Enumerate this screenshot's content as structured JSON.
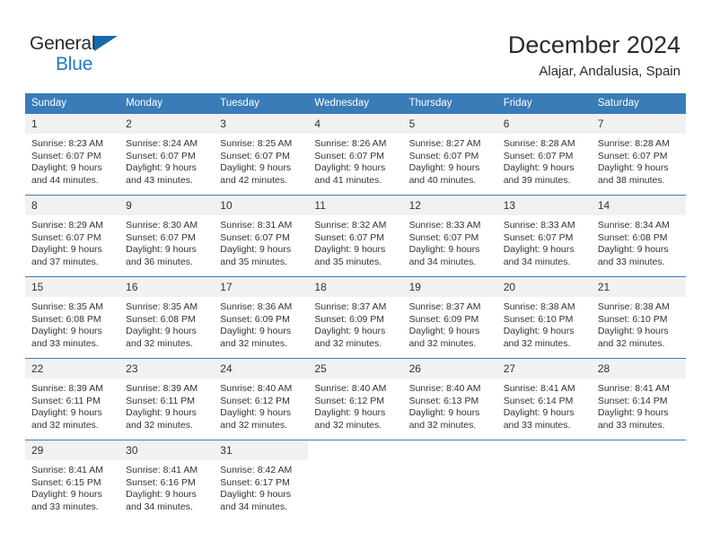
{
  "brand": {
    "line1": "General",
    "line2": "Blue",
    "triangle_icon": "triangle-icon",
    "color_dark": "#2b2b2b",
    "color_blue": "#1f7bc1"
  },
  "header": {
    "title": "December 2024",
    "subtitle": "Alajar, Andalusia, Spain"
  },
  "calendar": {
    "accent_color": "#3a7cb8",
    "daynum_background": "#f1f1f1",
    "weekday_headers": [
      "Sunday",
      "Monday",
      "Tuesday",
      "Wednesday",
      "Thursday",
      "Friday",
      "Saturday"
    ],
    "weeks": [
      [
        {
          "day": "1",
          "sunrise": "Sunrise: 8:23 AM",
          "sunset": "Sunset: 6:07 PM",
          "daylight_line1": "Daylight: 9 hours",
          "daylight_line2": "and 44 minutes."
        },
        {
          "day": "2",
          "sunrise": "Sunrise: 8:24 AM",
          "sunset": "Sunset: 6:07 PM",
          "daylight_line1": "Daylight: 9 hours",
          "daylight_line2": "and 43 minutes."
        },
        {
          "day": "3",
          "sunrise": "Sunrise: 8:25 AM",
          "sunset": "Sunset: 6:07 PM",
          "daylight_line1": "Daylight: 9 hours",
          "daylight_line2": "and 42 minutes."
        },
        {
          "day": "4",
          "sunrise": "Sunrise: 8:26 AM",
          "sunset": "Sunset: 6:07 PM",
          "daylight_line1": "Daylight: 9 hours",
          "daylight_line2": "and 41 minutes."
        },
        {
          "day": "5",
          "sunrise": "Sunrise: 8:27 AM",
          "sunset": "Sunset: 6:07 PM",
          "daylight_line1": "Daylight: 9 hours",
          "daylight_line2": "and 40 minutes."
        },
        {
          "day": "6",
          "sunrise": "Sunrise: 8:28 AM",
          "sunset": "Sunset: 6:07 PM",
          "daylight_line1": "Daylight: 9 hours",
          "daylight_line2": "and 39 minutes."
        },
        {
          "day": "7",
          "sunrise": "Sunrise: 8:28 AM",
          "sunset": "Sunset: 6:07 PM",
          "daylight_line1": "Daylight: 9 hours",
          "daylight_line2": "and 38 minutes."
        }
      ],
      [
        {
          "day": "8",
          "sunrise": "Sunrise: 8:29 AM",
          "sunset": "Sunset: 6:07 PM",
          "daylight_line1": "Daylight: 9 hours",
          "daylight_line2": "and 37 minutes."
        },
        {
          "day": "9",
          "sunrise": "Sunrise: 8:30 AM",
          "sunset": "Sunset: 6:07 PM",
          "daylight_line1": "Daylight: 9 hours",
          "daylight_line2": "and 36 minutes."
        },
        {
          "day": "10",
          "sunrise": "Sunrise: 8:31 AM",
          "sunset": "Sunset: 6:07 PM",
          "daylight_line1": "Daylight: 9 hours",
          "daylight_line2": "and 35 minutes."
        },
        {
          "day": "11",
          "sunrise": "Sunrise: 8:32 AM",
          "sunset": "Sunset: 6:07 PM",
          "daylight_line1": "Daylight: 9 hours",
          "daylight_line2": "and 35 minutes."
        },
        {
          "day": "12",
          "sunrise": "Sunrise: 8:33 AM",
          "sunset": "Sunset: 6:07 PM",
          "daylight_line1": "Daylight: 9 hours",
          "daylight_line2": "and 34 minutes."
        },
        {
          "day": "13",
          "sunrise": "Sunrise: 8:33 AM",
          "sunset": "Sunset: 6:07 PM",
          "daylight_line1": "Daylight: 9 hours",
          "daylight_line2": "and 34 minutes."
        },
        {
          "day": "14",
          "sunrise": "Sunrise: 8:34 AM",
          "sunset": "Sunset: 6:08 PM",
          "daylight_line1": "Daylight: 9 hours",
          "daylight_line2": "and 33 minutes."
        }
      ],
      [
        {
          "day": "15",
          "sunrise": "Sunrise: 8:35 AM",
          "sunset": "Sunset: 6:08 PM",
          "daylight_line1": "Daylight: 9 hours",
          "daylight_line2": "and 33 minutes."
        },
        {
          "day": "16",
          "sunrise": "Sunrise: 8:35 AM",
          "sunset": "Sunset: 6:08 PM",
          "daylight_line1": "Daylight: 9 hours",
          "daylight_line2": "and 32 minutes."
        },
        {
          "day": "17",
          "sunrise": "Sunrise: 8:36 AM",
          "sunset": "Sunset: 6:09 PM",
          "daylight_line1": "Daylight: 9 hours",
          "daylight_line2": "and 32 minutes."
        },
        {
          "day": "18",
          "sunrise": "Sunrise: 8:37 AM",
          "sunset": "Sunset: 6:09 PM",
          "daylight_line1": "Daylight: 9 hours",
          "daylight_line2": "and 32 minutes."
        },
        {
          "day": "19",
          "sunrise": "Sunrise: 8:37 AM",
          "sunset": "Sunset: 6:09 PM",
          "daylight_line1": "Daylight: 9 hours",
          "daylight_line2": "and 32 minutes."
        },
        {
          "day": "20",
          "sunrise": "Sunrise: 8:38 AM",
          "sunset": "Sunset: 6:10 PM",
          "daylight_line1": "Daylight: 9 hours",
          "daylight_line2": "and 32 minutes."
        },
        {
          "day": "21",
          "sunrise": "Sunrise: 8:38 AM",
          "sunset": "Sunset: 6:10 PM",
          "daylight_line1": "Daylight: 9 hours",
          "daylight_line2": "and 32 minutes."
        }
      ],
      [
        {
          "day": "22",
          "sunrise": "Sunrise: 8:39 AM",
          "sunset": "Sunset: 6:11 PM",
          "daylight_line1": "Daylight: 9 hours",
          "daylight_line2": "and 32 minutes."
        },
        {
          "day": "23",
          "sunrise": "Sunrise: 8:39 AM",
          "sunset": "Sunset: 6:11 PM",
          "daylight_line1": "Daylight: 9 hours",
          "daylight_line2": "and 32 minutes."
        },
        {
          "day": "24",
          "sunrise": "Sunrise: 8:40 AM",
          "sunset": "Sunset: 6:12 PM",
          "daylight_line1": "Daylight: 9 hours",
          "daylight_line2": "and 32 minutes."
        },
        {
          "day": "25",
          "sunrise": "Sunrise: 8:40 AM",
          "sunset": "Sunset: 6:12 PM",
          "daylight_line1": "Daylight: 9 hours",
          "daylight_line2": "and 32 minutes."
        },
        {
          "day": "26",
          "sunrise": "Sunrise: 8:40 AM",
          "sunset": "Sunset: 6:13 PM",
          "daylight_line1": "Daylight: 9 hours",
          "daylight_line2": "and 32 minutes."
        },
        {
          "day": "27",
          "sunrise": "Sunrise: 8:41 AM",
          "sunset": "Sunset: 6:14 PM",
          "daylight_line1": "Daylight: 9 hours",
          "daylight_line2": "and 33 minutes."
        },
        {
          "day": "28",
          "sunrise": "Sunrise: 8:41 AM",
          "sunset": "Sunset: 6:14 PM",
          "daylight_line1": "Daylight: 9 hours",
          "daylight_line2": "and 33 minutes."
        }
      ],
      [
        {
          "day": "29",
          "sunrise": "Sunrise: 8:41 AM",
          "sunset": "Sunset: 6:15 PM",
          "daylight_line1": "Daylight: 9 hours",
          "daylight_line2": "and 33 minutes."
        },
        {
          "day": "30",
          "sunrise": "Sunrise: 8:41 AM",
          "sunset": "Sunset: 6:16 PM",
          "daylight_line1": "Daylight: 9 hours",
          "daylight_line2": "and 34 minutes."
        },
        {
          "day": "31",
          "sunrise": "Sunrise: 8:42 AM",
          "sunset": "Sunset: 6:17 PM",
          "daylight_line1": "Daylight: 9 hours",
          "daylight_line2": "and 34 minutes."
        },
        {
          "day": "",
          "sunrise": "",
          "sunset": "",
          "daylight_line1": "",
          "daylight_line2": ""
        },
        {
          "day": "",
          "sunrise": "",
          "sunset": "",
          "daylight_line1": "",
          "daylight_line2": ""
        },
        {
          "day": "",
          "sunrise": "",
          "sunset": "",
          "daylight_line1": "",
          "daylight_line2": ""
        },
        {
          "day": "",
          "sunrise": "",
          "sunset": "",
          "daylight_line1": "",
          "daylight_line2": ""
        }
      ]
    ]
  }
}
